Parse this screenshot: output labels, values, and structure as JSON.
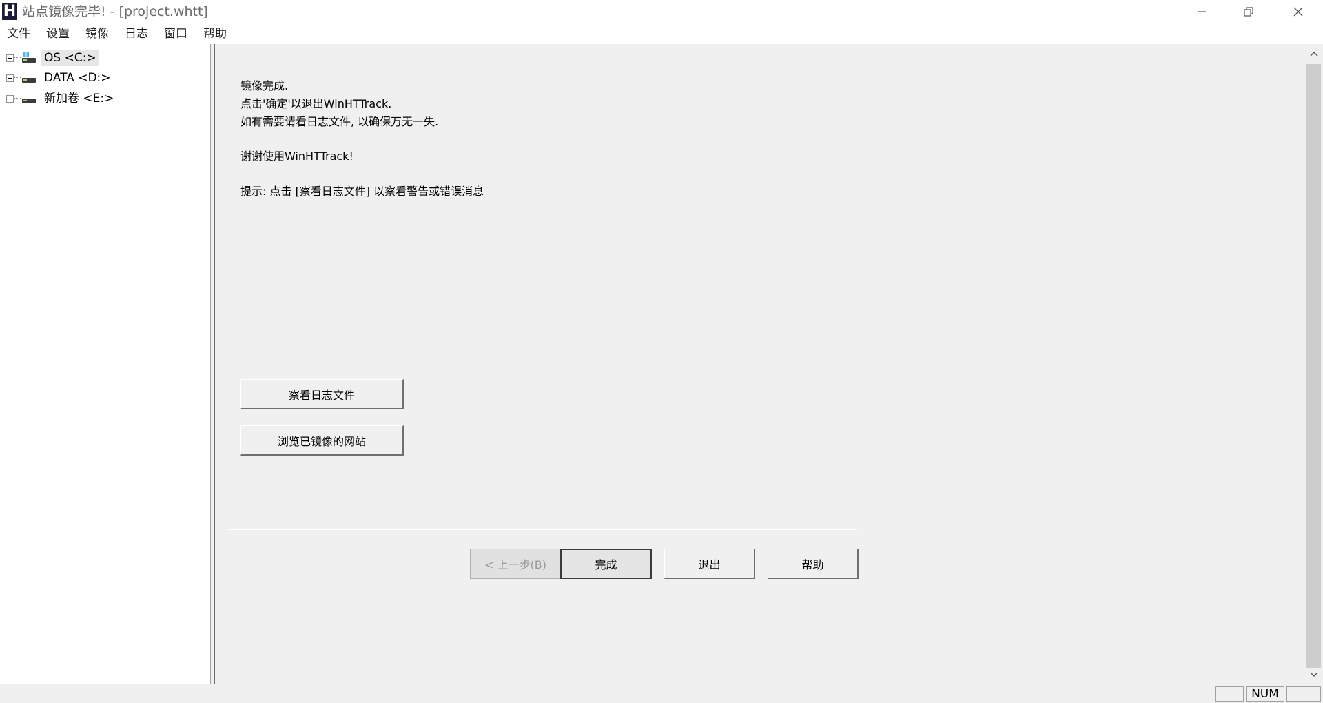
{
  "window": {
    "app_icon_letter": "H",
    "title": "站点镜像完毕! - [project.whtt]"
  },
  "menu": [
    "文件",
    "设置",
    "镜像",
    "日志",
    "窗口",
    "帮助"
  ],
  "tree": {
    "drives": [
      {
        "label": "OS <C:>",
        "icon": "system-drive-icon",
        "selected": true
      },
      {
        "label": "DATA <D:>",
        "icon": "drive-icon",
        "selected": false
      },
      {
        "label": "新加卷 <E:>",
        "icon": "drive-icon",
        "selected": false
      }
    ]
  },
  "content": {
    "messages": [
      "镜像完成.",
      "点击'确定'以退出WinHTTrack.",
      "如有需要请看日志文件, 以确保万无一失.",
      "谢谢使用WinHTTrack!",
      "提示: 点击 [察看日志文件] 以察看警告或错误消息"
    ],
    "view_log_button": "察看日志文件",
    "browse_site_button": "浏览已镜像的网站"
  },
  "wizard": {
    "back_button": "< 上一步(B)",
    "finish_button": "完成",
    "exit_button": "退出",
    "help_button": "帮助"
  },
  "statusbar": {
    "num_indicator": "NUM"
  }
}
